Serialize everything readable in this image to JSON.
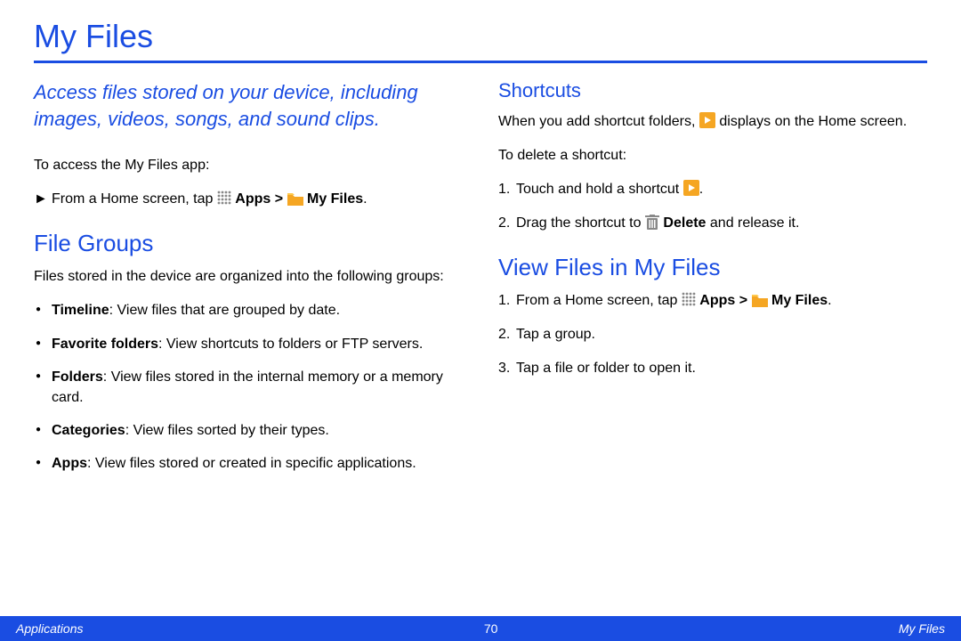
{
  "page_title": "My Files",
  "intro": "Access files stored on your device, including images, videos, songs, and sound clips.",
  "access_label": "To access the My Files app:",
  "access_step_prefix": "From a Home screen, tap ",
  "apps_label": "Apps",
  "gt": " > ",
  "myfiles_label": "My Files",
  "period": ".",
  "file_groups": {
    "heading": "File Groups",
    "desc": "Files stored in the device are organized into the following groups:",
    "items": [
      {
        "term": "Timeline",
        "desc": ": View files that are grouped by date."
      },
      {
        "term": "Favorite folders",
        "desc": ": View shortcuts to folders or FTP servers."
      },
      {
        "term": "Folders",
        "desc": ": View files stored in the internal memory or a memory card."
      },
      {
        "term": "Categories",
        "desc": ": View files sorted by their types."
      },
      {
        "term": "Apps",
        "desc": ": View files stored or created in specific applications."
      }
    ]
  },
  "shortcuts": {
    "heading": "Shortcuts",
    "line1_a": "When you add shortcut folders, ",
    "line1_b": " displays on the Home screen.",
    "delete_label": "To delete a shortcut:",
    "step1": "Touch and hold a shortcut ",
    "step2_a": "Drag the shortcut to ",
    "step2_b": "Delete",
    "step2_c": " and release it."
  },
  "view_files": {
    "heading": "View Files in My Files",
    "step1_prefix": "From a Home screen, tap ",
    "step2": "Tap a group.",
    "step3": "Tap a file or folder to open it."
  },
  "footer": {
    "left": "Applications",
    "page": "70",
    "right": "My Files"
  }
}
